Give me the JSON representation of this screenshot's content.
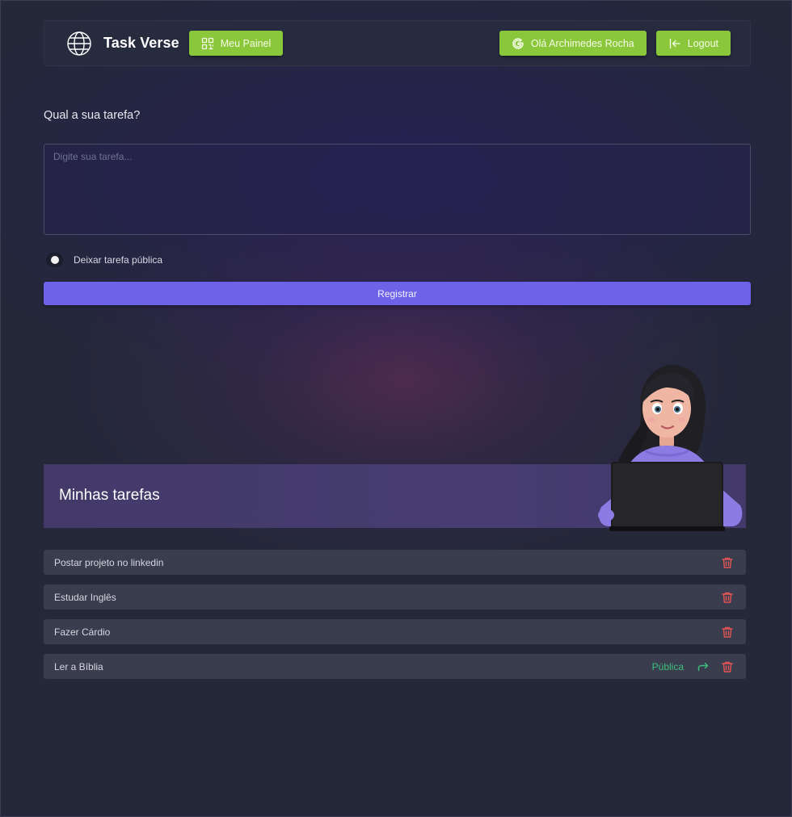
{
  "header": {
    "brand": "Task Verse",
    "panel_button": "Meu Painel",
    "user_button": "Olá Archimedes Rocha",
    "logout_button": "Logout",
    "icons": {
      "logo": "globe-icon",
      "panel": "qr-grid-icon",
      "user": "google-icon",
      "logout": "logout-arrow-icon"
    }
  },
  "form": {
    "question": "Qual a sua tarefa?",
    "input_placeholder": "Digite sua tarefa...",
    "input_value": "",
    "public_toggle_label": "Deixar tarefa pública",
    "public_toggle_on": false,
    "register_button": "Registrar"
  },
  "tasks_section": {
    "title": "Minhas tarefas",
    "tasks": [
      {
        "text": "Postar projeto no linkedin",
        "public": false
      },
      {
        "text": "Estudar Inglês",
        "public": false
      },
      {
        "text": "Fazer Cárdio",
        "public": false
      },
      {
        "text": "Ler a Bíblia",
        "public": true,
        "public_label": "Pública"
      }
    ]
  },
  "colors": {
    "accent_green": "#8bc73a",
    "primary_purple": "#6c63e9",
    "public_green": "#3cc07a",
    "trash_red": "#e25555",
    "background": "#242839"
  }
}
